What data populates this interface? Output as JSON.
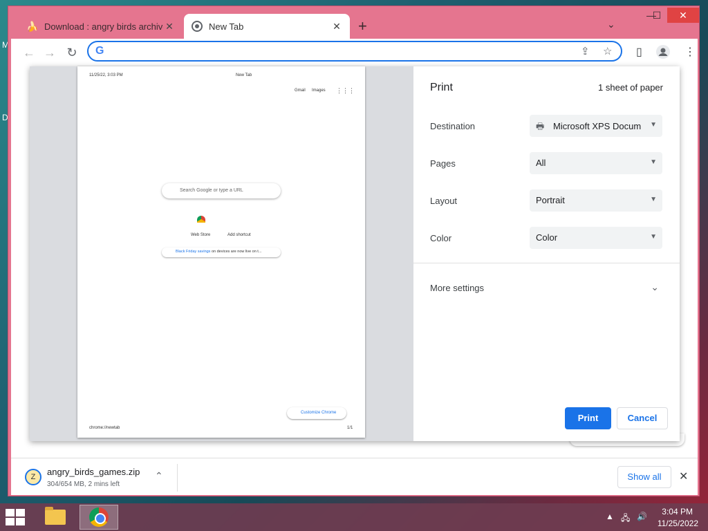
{
  "desktop": {
    "edge_letters": [
      "M",
      "D"
    ]
  },
  "browser": {
    "tabs": [
      {
        "title": "Download : angry birds archive [",
        "favicon": "banana-icon",
        "active": false
      },
      {
        "title": "New Tab",
        "favicon": "chrome-icon",
        "active": true
      }
    ],
    "omnibox": {
      "value": "",
      "placeholder": ""
    },
    "window_controls": {
      "minimize": "—",
      "maximize": "☐",
      "close": "✕"
    }
  },
  "print_dialog": {
    "title": "Print",
    "sheets": "1 sheet of paper",
    "destination": {
      "label": "Destination",
      "value": "Microsoft XPS Docum"
    },
    "pages": {
      "label": "Pages",
      "value": "All"
    },
    "layout": {
      "label": "Layout",
      "value": "Portrait"
    },
    "color": {
      "label": "Color",
      "value": "Color"
    },
    "more_settings": "More settings",
    "print_button": "Print",
    "cancel_button": "Cancel"
  },
  "preview": {
    "header_date": "11/25/22, 3:03 PM",
    "header_title": "New Tab",
    "gmail": "Gmail",
    "images": "Images",
    "search_placeholder": "Search Google or type a URL",
    "shortcut1": "Web Store",
    "shortcut2": "Add shortcut",
    "notice_link": "Black Friday savings",
    "notice_rest": " on devices are now live on t...",
    "customize": "Customize Chrome",
    "footer_url": "chrome://newtab",
    "footer_page": "1/1"
  },
  "downloads": {
    "filename": "angry_birds_games.zip",
    "status": "304/654 MB, 2 mins left",
    "show_all": "Show all"
  },
  "taskbar": {
    "time": "3:04 PM",
    "date": "11/25/2022"
  }
}
